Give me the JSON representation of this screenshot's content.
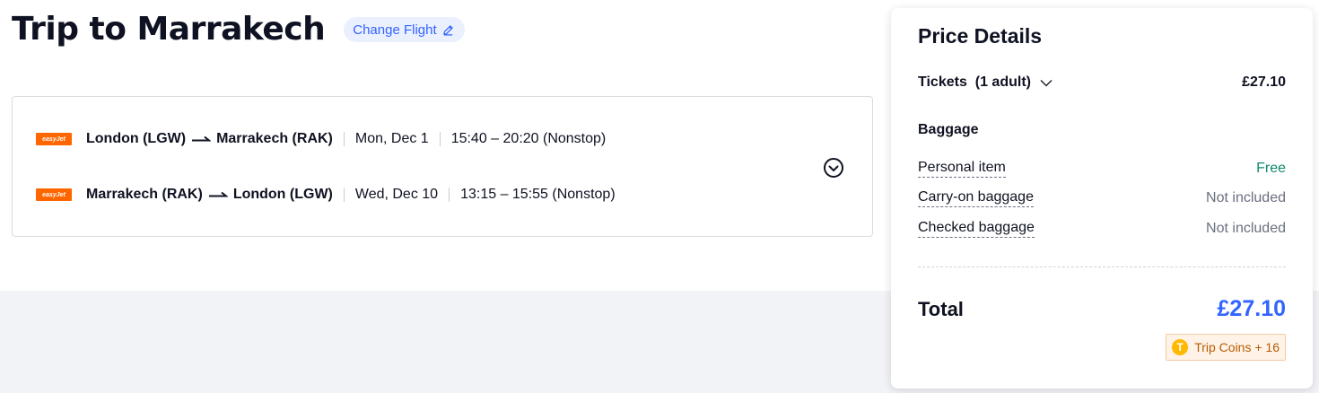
{
  "page": {
    "title": "Trip to Marrakech",
    "change_flight_label": "Change Flight"
  },
  "flights": {
    "legs": [
      {
        "airline": "easyJet",
        "origin": "London (LGW)",
        "destination": "Marrakech (RAK)",
        "date": "Mon, Dec 1",
        "time": "15:40 – 20:20 (Nonstop)"
      },
      {
        "airline": "easyJet",
        "origin": "Marrakech (RAK)",
        "destination": "London (LGW)",
        "date": "Wed, Dec 10",
        "time": "13:15 – 15:55 (Nonstop)"
      }
    ]
  },
  "price_details": {
    "title": "Price Details",
    "tickets_label": "Tickets",
    "tickets_count": "(1 adult)",
    "tickets_price": "£27.10",
    "baggage_heading": "Baggage",
    "baggage": [
      {
        "label": "Personal item",
        "value": "Free"
      },
      {
        "label": "Carry-on baggage",
        "value": "Not included"
      },
      {
        "label": "Checked baggage",
        "value": "Not included"
      }
    ],
    "total_label": "Total",
    "total_value": "£27.10",
    "coins_label": "Trip Coins + 16"
  },
  "colors": {
    "accent": "#3264ff",
    "free": "#0f8a6e",
    "airline": "#ff6600",
    "coin": "#ffb800"
  },
  "icons": [
    "pencil-icon",
    "arrow-right-icon",
    "chevron-down-circle-icon",
    "chevron-down-icon",
    "coin-icon"
  ]
}
